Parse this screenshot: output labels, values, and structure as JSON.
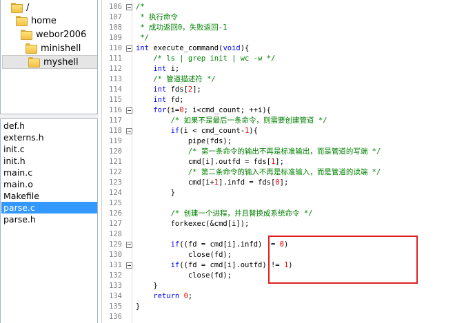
{
  "folder_tree": [
    {
      "label": "/",
      "icon": "folder-icon"
    },
    {
      "label": "home",
      "icon": "folder-icon"
    },
    {
      "label": "webor2006",
      "icon": "folder-icon"
    },
    {
      "label": "minishell",
      "icon": "folder-icon"
    },
    {
      "label": "myshell",
      "icon": "folder-icon",
      "selected": true
    }
  ],
  "files": [
    {
      "label": "def.h"
    },
    {
      "label": "externs.h"
    },
    {
      "label": "init.c"
    },
    {
      "label": "init.h"
    },
    {
      "label": "main.c"
    },
    {
      "label": "main.o"
    },
    {
      "label": "Makefile"
    },
    {
      "label": "parse.c",
      "selected": true
    },
    {
      "label": "parse.h"
    }
  ],
  "editor": {
    "first_line": 106,
    "highlight_color": "#e02020",
    "lines": [
      {
        "n": "106",
        "fold": true,
        "tokens": [
          [
            "c",
            "/*"
          ]
        ]
      },
      {
        "n": "107",
        "fold": false,
        "tokens": [
          [
            "c",
            " * 执行命令"
          ]
        ]
      },
      {
        "n": "108",
        "fold": false,
        "tokens": [
          [
            "c",
            " * 成功返回0，失败返回-1"
          ]
        ]
      },
      {
        "n": "109",
        "fold": false,
        "tokens": [
          [
            "c",
            " */"
          ]
        ]
      },
      {
        "n": "110",
        "fold": true,
        "tokens": [
          [
            "k",
            "int"
          ],
          [
            "t",
            " execute_command("
          ],
          [
            "k",
            "void"
          ],
          [
            "t",
            "){"
          ]
        ]
      },
      {
        "n": "111",
        "fold": false,
        "tokens": [
          [
            "t",
            "    "
          ],
          [
            "c",
            "/* ls | grep init | wc -w */"
          ]
        ]
      },
      {
        "n": "112",
        "fold": false,
        "tokens": [
          [
            "t",
            "    "
          ],
          [
            "k",
            "int"
          ],
          [
            "t",
            " i;"
          ]
        ]
      },
      {
        "n": "113",
        "fold": false,
        "tokens": [
          [
            "t",
            "    "
          ],
          [
            "c",
            "/* 管道描述符 */"
          ]
        ]
      },
      {
        "n": "114",
        "fold": false,
        "tokens": [
          [
            "t",
            "    "
          ],
          [
            "k",
            "int"
          ],
          [
            "t",
            " fds["
          ],
          [
            "n",
            "2"
          ],
          [
            "t",
            "];"
          ]
        ]
      },
      {
        "n": "115",
        "fold": false,
        "tokens": [
          [
            "t",
            "    "
          ],
          [
            "k",
            "int"
          ],
          [
            "t",
            " fd;"
          ]
        ]
      },
      {
        "n": "116",
        "fold": true,
        "tokens": [
          [
            "t",
            "    "
          ],
          [
            "k",
            "for"
          ],
          [
            "t",
            "(i="
          ],
          [
            "n",
            "0"
          ],
          [
            "t",
            "; i<cmd_count; ++i){"
          ]
        ]
      },
      {
        "n": "117",
        "fold": false,
        "tokens": [
          [
            "t",
            "        "
          ],
          [
            "c",
            "/* 如果不是最后一条命令，则需要创建管道 */"
          ]
        ]
      },
      {
        "n": "118",
        "fold": true,
        "tokens": [
          [
            "t",
            "        "
          ],
          [
            "k",
            "if"
          ],
          [
            "t",
            "(i < cmd_count-"
          ],
          [
            "n",
            "1"
          ],
          [
            "t",
            "){"
          ]
        ]
      },
      {
        "n": "119",
        "fold": false,
        "tokens": [
          [
            "t",
            "            pipe(fds);"
          ]
        ]
      },
      {
        "n": "120",
        "fold": false,
        "tokens": [
          [
            "t",
            "            "
          ],
          [
            "c",
            "/* 第一条命令的输出不再是标准输出，而是管道的写端 */"
          ]
        ]
      },
      {
        "n": "121",
        "fold": false,
        "tokens": [
          [
            "t",
            "            cmd[i].outfd = fds["
          ],
          [
            "n",
            "1"
          ],
          [
            "t",
            "];"
          ]
        ]
      },
      {
        "n": "122",
        "fold": false,
        "tokens": [
          [
            "t",
            "            "
          ],
          [
            "c",
            "/* 第二条命令的输入不再是标准输入，而是管道的读端 */"
          ]
        ]
      },
      {
        "n": "123",
        "fold": false,
        "tokens": [
          [
            "t",
            "            cmd[i+"
          ],
          [
            "n",
            "1"
          ],
          [
            "t",
            "].infd = fds["
          ],
          [
            "n",
            "0"
          ],
          [
            "t",
            "];"
          ]
        ]
      },
      {
        "n": "124",
        "fold": false,
        "tokens": [
          [
            "t",
            "        }"
          ]
        ]
      },
      {
        "n": "125",
        "fold": false,
        "tokens": []
      },
      {
        "n": "126",
        "fold": false,
        "tokens": [
          [
            "t",
            "        "
          ],
          [
            "c",
            "/* 创建一个进程，并且替换成系统命令 */"
          ]
        ]
      },
      {
        "n": "127",
        "fold": false,
        "tokens": [
          [
            "t",
            "        forkexec(&cmd[i]);"
          ]
        ]
      },
      {
        "n": "128",
        "fold": false,
        "tokens": []
      },
      {
        "n": "129",
        "fold": true,
        "tokens": [
          [
            "t",
            "        "
          ],
          [
            "k",
            "if"
          ],
          [
            "t",
            "((fd = cmd[i].infd) != "
          ],
          [
            "n",
            "0"
          ],
          [
            "t",
            ")"
          ]
        ]
      },
      {
        "n": "130",
        "fold": false,
        "tokens": [
          [
            "t",
            "            close(fd);"
          ]
        ]
      },
      {
        "n": "131",
        "fold": true,
        "tokens": [
          [
            "t",
            "        "
          ],
          [
            "k",
            "if"
          ],
          [
            "t",
            "((fd = cmd[i].outfd) != "
          ],
          [
            "n",
            "1"
          ],
          [
            "t",
            ")"
          ]
        ]
      },
      {
        "n": "132",
        "fold": false,
        "tokens": [
          [
            "t",
            "            close(fd);"
          ]
        ]
      },
      {
        "n": "133",
        "fold": false,
        "tokens": [
          [
            "t",
            "    }"
          ]
        ]
      },
      {
        "n": "134",
        "fold": false,
        "tokens": [
          [
            "t",
            "    "
          ],
          [
            "k",
            "return"
          ],
          [
            "t",
            " "
          ],
          [
            "n",
            "0"
          ],
          [
            "t",
            ";"
          ]
        ]
      },
      {
        "n": "135",
        "fold": false,
        "tokens": [
          [
            "t",
            "}"
          ]
        ]
      },
      {
        "n": "136",
        "fold": false,
        "tokens": []
      }
    ]
  }
}
